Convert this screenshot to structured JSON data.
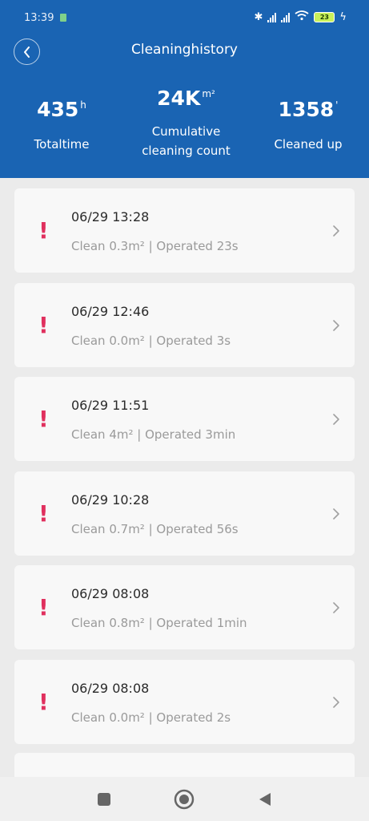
{
  "status_bar": {
    "time": "13:39",
    "battery": "23"
  },
  "header": {
    "title": "Cleaninghistory",
    "stats": [
      {
        "value": "435",
        "unit": "h",
        "label": "Totaltime"
      },
      {
        "value": "24K",
        "unit": "m²",
        "label_line1": "Cumulative",
        "label_line2": "cleaning count"
      },
      {
        "value": "1358",
        "unit": "'",
        "label": "Cleaned up"
      }
    ]
  },
  "records": [
    {
      "time": "06/29 13:28",
      "detail": "Clean 0.3m² | Operated 23s"
    },
    {
      "time": "06/29 12:46",
      "detail": "Clean 0.0m² | Operated 3s"
    },
    {
      "time": "06/29 11:51",
      "detail": "Clean 4m² | Operated 3min"
    },
    {
      "time": "06/29 10:28",
      "detail": "Clean 0.7m² | Operated 56s"
    },
    {
      "time": "06/29 08:08",
      "detail": "Clean 0.8m² | Operated 1min"
    },
    {
      "time": "06/29 08:08",
      "detail": "Clean 0.0m² | Operated 2s"
    }
  ],
  "colors": {
    "header_bg": "#1a64b3",
    "alert": "#e0305e"
  },
  "icons": {
    "back": "chevron-left-icon",
    "alert": "exclamation-icon",
    "row": "chevron-right-icon",
    "nav": [
      "square-icon",
      "home-circle-icon",
      "back-triangle-icon"
    ]
  }
}
